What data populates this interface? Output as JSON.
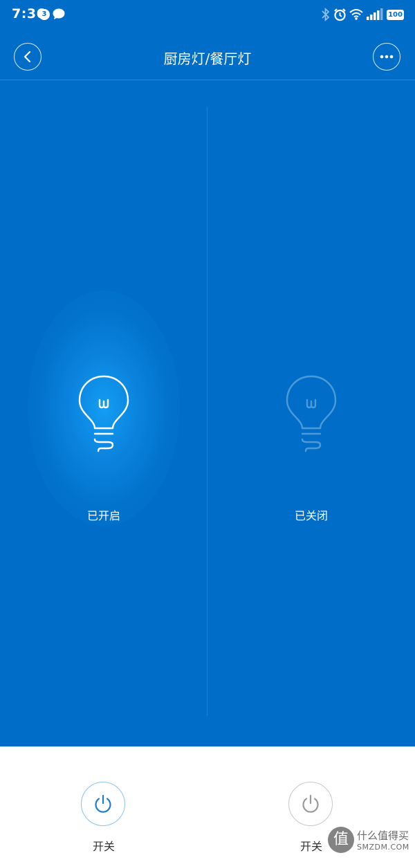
{
  "status_bar": {
    "time": "7:36",
    "notification_count": "3",
    "battery": "100",
    "icons": [
      "chat-bubble-icon",
      "bluetooth-icon",
      "alarm-icon",
      "wifi-icon",
      "signal-icon",
      "battery-icon"
    ]
  },
  "header": {
    "title": "厨房灯/餐厅灯",
    "back_icon": "chevron-left-icon",
    "more_icon": "more-dots-icon"
  },
  "lamps": [
    {
      "state_label": "已开启",
      "on": true,
      "icon": "light-bulb-icon"
    },
    {
      "state_label": "已关闭",
      "on": false,
      "icon": "light-bulb-icon"
    }
  ],
  "controls": [
    {
      "label": "开关",
      "icon": "power-icon",
      "active": true
    },
    {
      "label": "开关",
      "icon": "power-icon",
      "active": false
    }
  ],
  "watermark": {
    "logo_glyph": "值",
    "text_cn": "什么值得买",
    "text_en": "SMZDM.COM"
  },
  "colors": {
    "background_blue": "#006ec8",
    "glow_blue": "#14a0f5",
    "power_active": "#1a7fd0",
    "power_inactive": "#9a9a9a",
    "panel_white": "#ffffff"
  }
}
